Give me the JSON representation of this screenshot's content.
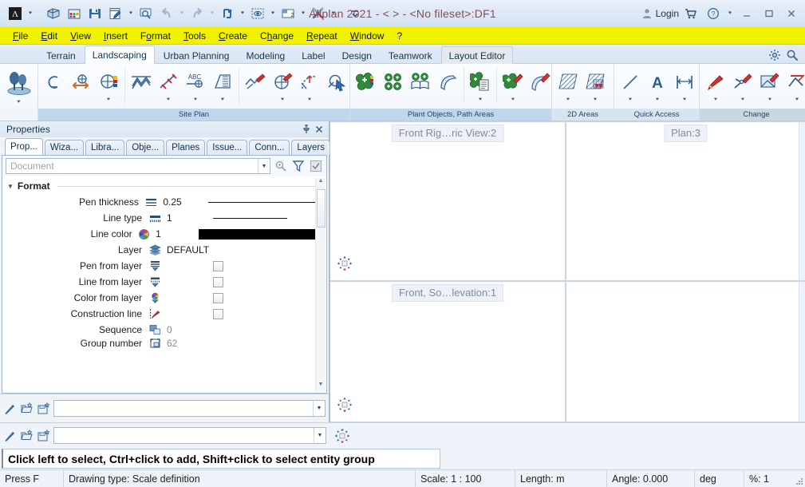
{
  "titlebar": {
    "app_logo": "allplan-logo-icon",
    "title": "Allplan 2021 - <      > - <No fileset>:DF1",
    "login_label": "Login",
    "quick_access": [
      {
        "name": "allplan-logo-icon",
        "caret": true
      },
      {
        "name": "project-open-icon",
        "caret": false
      },
      {
        "name": "drawing-files-icon",
        "caret": false
      },
      {
        "name": "save-icon",
        "caret": false
      },
      {
        "name": "new-drawing-icon",
        "caret": true
      },
      {
        "name": "preview-icon",
        "caret": false
      },
      {
        "name": "undo-icon",
        "caret": true
      },
      {
        "name": "redo-icon",
        "caret": true
      },
      {
        "name": "refresh-icon",
        "caret": true
      },
      {
        "name": "visibility-icon",
        "caret": true
      },
      {
        "name": "window-layout-icon",
        "caret": true
      },
      {
        "name": "configure-tools-icon",
        "caret": true
      },
      {
        "name": "more-options-icon",
        "caret": false
      }
    ],
    "window_buttons": [
      {
        "name": "cart-icon",
        "glyph": "cart"
      },
      {
        "name": "help-icon",
        "glyph": "?"
      },
      {
        "name": "help-dropdown-icon",
        "glyph": "caret"
      },
      {
        "name": "minimize-button",
        "glyph": "_"
      },
      {
        "name": "maximize-button",
        "glyph": "□"
      },
      {
        "name": "close-button",
        "glyph": "✕"
      }
    ]
  },
  "menubar": {
    "items": [
      {
        "label": "File",
        "accel": "F"
      },
      {
        "label": "Edit",
        "accel": "E"
      },
      {
        "label": "View",
        "accel": "V"
      },
      {
        "label": "Insert",
        "accel": "I"
      },
      {
        "label": "Format",
        "accel": "o"
      },
      {
        "label": "Tools",
        "accel": "T"
      },
      {
        "label": "Create",
        "accel": "C"
      },
      {
        "label": "Change",
        "accel": "h"
      },
      {
        "label": "Repeat",
        "accel": "R"
      },
      {
        "label": "Window",
        "accel": "W"
      },
      {
        "label": "?",
        "accel": ""
      }
    ]
  },
  "ribbon_tabs": {
    "items": [
      {
        "label": "Terrain",
        "state": "normal"
      },
      {
        "label": "Landscaping",
        "state": "active"
      },
      {
        "label": "Urban Planning",
        "state": "normal"
      },
      {
        "label": "Modeling",
        "state": "normal"
      },
      {
        "label": "Label",
        "state": "normal"
      },
      {
        "label": "Design",
        "state": "normal"
      },
      {
        "label": "Teamwork",
        "state": "normal"
      },
      {
        "label": "Layout Editor",
        "state": "alt"
      }
    ],
    "right_icons": [
      {
        "name": "settings-gear-icon"
      },
      {
        "name": "search-icon"
      }
    ]
  },
  "ribbon": {
    "launcher": {
      "name": "landscaping-trees-icon",
      "caret": true
    },
    "groups": [
      {
        "label": "Site Plan",
        "label_shade": "shade1",
        "subgroups": [
          [
            {
              "name": "site-plan-boundary-icon",
              "caret": false
            },
            {
              "name": "site-plan-move-icon",
              "caret": false
            },
            {
              "name": "site-plan-color-icon",
              "caret": true
            }
          ],
          [
            {
              "name": "terrain-section-icon",
              "caret": false
            },
            {
              "name": "terrain-point-icon",
              "caret": true
            },
            {
              "name": "abc-label-point-icon",
              "caret": true
            },
            {
              "name": "building-site-icon",
              "caret": true
            }
          ],
          [
            {
              "name": "modify-terrain-icon",
              "caret": false
            },
            {
              "name": "modify-site-plan-icon",
              "caret": true
            },
            {
              "name": "modify-elevation-icon",
              "caret": true
            },
            {
              "name": "modify-select-icon",
              "caret": false
            }
          ]
        ]
      },
      {
        "label": "Plant Objects, Path Areas",
        "label_shade": "shade1",
        "subgroups": [
          [
            {
              "name": "plant-color-icon",
              "caret": false
            },
            {
              "name": "plant-group-icon",
              "caret": false
            },
            {
              "name": "plant-catalog-icon",
              "caret": false
            },
            {
              "name": "path-area-icon",
              "caret": false
            }
          ],
          [
            {
              "name": "plant-list-icon",
              "caret": true
            }
          ],
          [
            {
              "name": "modify-plant-icon",
              "caret": true
            },
            {
              "name": "modify-path-area-icon",
              "caret": false
            }
          ]
        ]
      },
      {
        "label": "2D Areas",
        "label_shade": "shade2",
        "subgroups": [
          [
            {
              "name": "hatching-area-icon",
              "caret": true
            },
            {
              "name": "pattern-area-icon",
              "caret": true
            }
          ]
        ]
      },
      {
        "label": "Quick Access",
        "label_shade": "shade2",
        "subgroups": [
          [
            {
              "name": "line-icon",
              "caret": true
            },
            {
              "name": "text-icon",
              "caret": true
            },
            {
              "name": "dimension-line-icon",
              "caret": true
            }
          ]
        ]
      },
      {
        "label": "Change",
        "label_shade": "shade3",
        "subgroups": [
          [
            {
              "name": "modify-format-properties-icon",
              "caret": true
            },
            {
              "name": "modify-point-icon",
              "caret": true
            },
            {
              "name": "modify-entity-icon",
              "caret": true
            },
            {
              "name": "modify-angle-icon",
              "caret": true
            }
          ]
        ]
      }
    ]
  },
  "properties": {
    "title": "Properties",
    "pin_icon": "pin-icon",
    "close_icon": "close-icon",
    "tabs": [
      {
        "label": "Prop...",
        "active": true
      },
      {
        "label": "Wiza...",
        "active": false
      },
      {
        "label": "Libra...",
        "active": false
      },
      {
        "label": "Obje...",
        "active": false
      },
      {
        "label": "Planes",
        "active": false
      },
      {
        "label": "Issue...",
        "active": false
      },
      {
        "label": "Conn...",
        "active": false
      },
      {
        "label": "Layers",
        "active": false
      }
    ],
    "filter": {
      "value": "",
      "placeholder": "Document",
      "buttons": [
        {
          "name": "zoom-search-icon"
        },
        {
          "name": "filter-funnel-icon"
        },
        {
          "name": "apply-check-icon"
        }
      ]
    },
    "section": {
      "label": "Format",
      "expanded": true
    },
    "rows": [
      {
        "label": "Pen thickness",
        "icon": "pen-thickness-icon",
        "value": "0.25",
        "extra": "thick-line",
        "dim": false
      },
      {
        "label": "Line type",
        "icon": "line-type-icon",
        "value": "1",
        "extra": "thin-line",
        "dim": false
      },
      {
        "label": "Line color",
        "icon": "color-wheel-icon",
        "value": "1",
        "extra": "black-swatch",
        "dim": false
      },
      {
        "label": "Layer",
        "icon": "layers-icon",
        "value": "DEFAULT",
        "extra": "none",
        "dim": false
      },
      {
        "label": "Pen from layer",
        "icon": "pen-from-layer-icon",
        "value": "",
        "extra": "checkbox",
        "dim": false
      },
      {
        "label": "Line from layer",
        "icon": "line-from-layer-icon",
        "value": "",
        "extra": "checkbox",
        "dim": false
      },
      {
        "label": "Color from layer",
        "icon": "color-from-layer-icon",
        "value": "",
        "extra": "checkbox",
        "dim": false
      },
      {
        "label": "Construction line",
        "icon": "construction-line-icon",
        "value": "",
        "extra": "checkbox",
        "dim": false
      },
      {
        "label": "Sequence",
        "icon": "sequence-icon",
        "value": "0",
        "extra": "none",
        "dim": true
      },
      {
        "label": "Group number",
        "icon": "group-number-icon",
        "value": "62",
        "extra": "none",
        "dim": true
      }
    ],
    "footer": {
      "icons": [
        {
          "name": "pick-properties-icon"
        },
        {
          "name": "load-favorite-icon"
        },
        {
          "name": "save-favorite-icon"
        }
      ],
      "combo_value": ""
    }
  },
  "viewports": [
    {
      "label": "Front Rig…ric View:2",
      "compass": "compass-south-icon",
      "position": "top-left"
    },
    {
      "label": "Plan:3",
      "compass": "",
      "position": "top-right"
    },
    {
      "label": "Front, So…levation:1",
      "compass": "compass-south-red-icon",
      "position": "bottom-left"
    },
    {
      "label": "",
      "compass": "compass-center-red-icon",
      "position": "bottom-right"
    }
  ],
  "command_bar": {
    "icons": [
      {
        "name": "pick-match-icon"
      },
      {
        "name": "open-favorite-icon"
      },
      {
        "name": "save-favorite-icon"
      }
    ],
    "input_value": "",
    "compass_icon": "compass-south-red-icon"
  },
  "prompt": {
    "text": "Click left to select, Ctrl+click to add, Shift+click to select entity group"
  },
  "statusbar": {
    "cells": [
      {
        "name": "press-f",
        "text": "Press F"
      },
      {
        "name": "drawing-type",
        "text": "Drawing type:  Scale definition"
      },
      {
        "name": "scale",
        "text": "Scale:  1 : 100"
      },
      {
        "name": "length-unit",
        "text": "Length:  m"
      },
      {
        "name": "angle",
        "text": "Angle:  0.000"
      },
      {
        "name": "angle-unit",
        "text": "deg"
      },
      {
        "name": "percent",
        "text": "%:  1"
      }
    ]
  },
  "colors": {
    "menu_yellow": "#f2f200",
    "title_text": "#8b4a5a",
    "ribbon_group_label": "#bfd6ec",
    "accent_blue": "#23486b"
  }
}
